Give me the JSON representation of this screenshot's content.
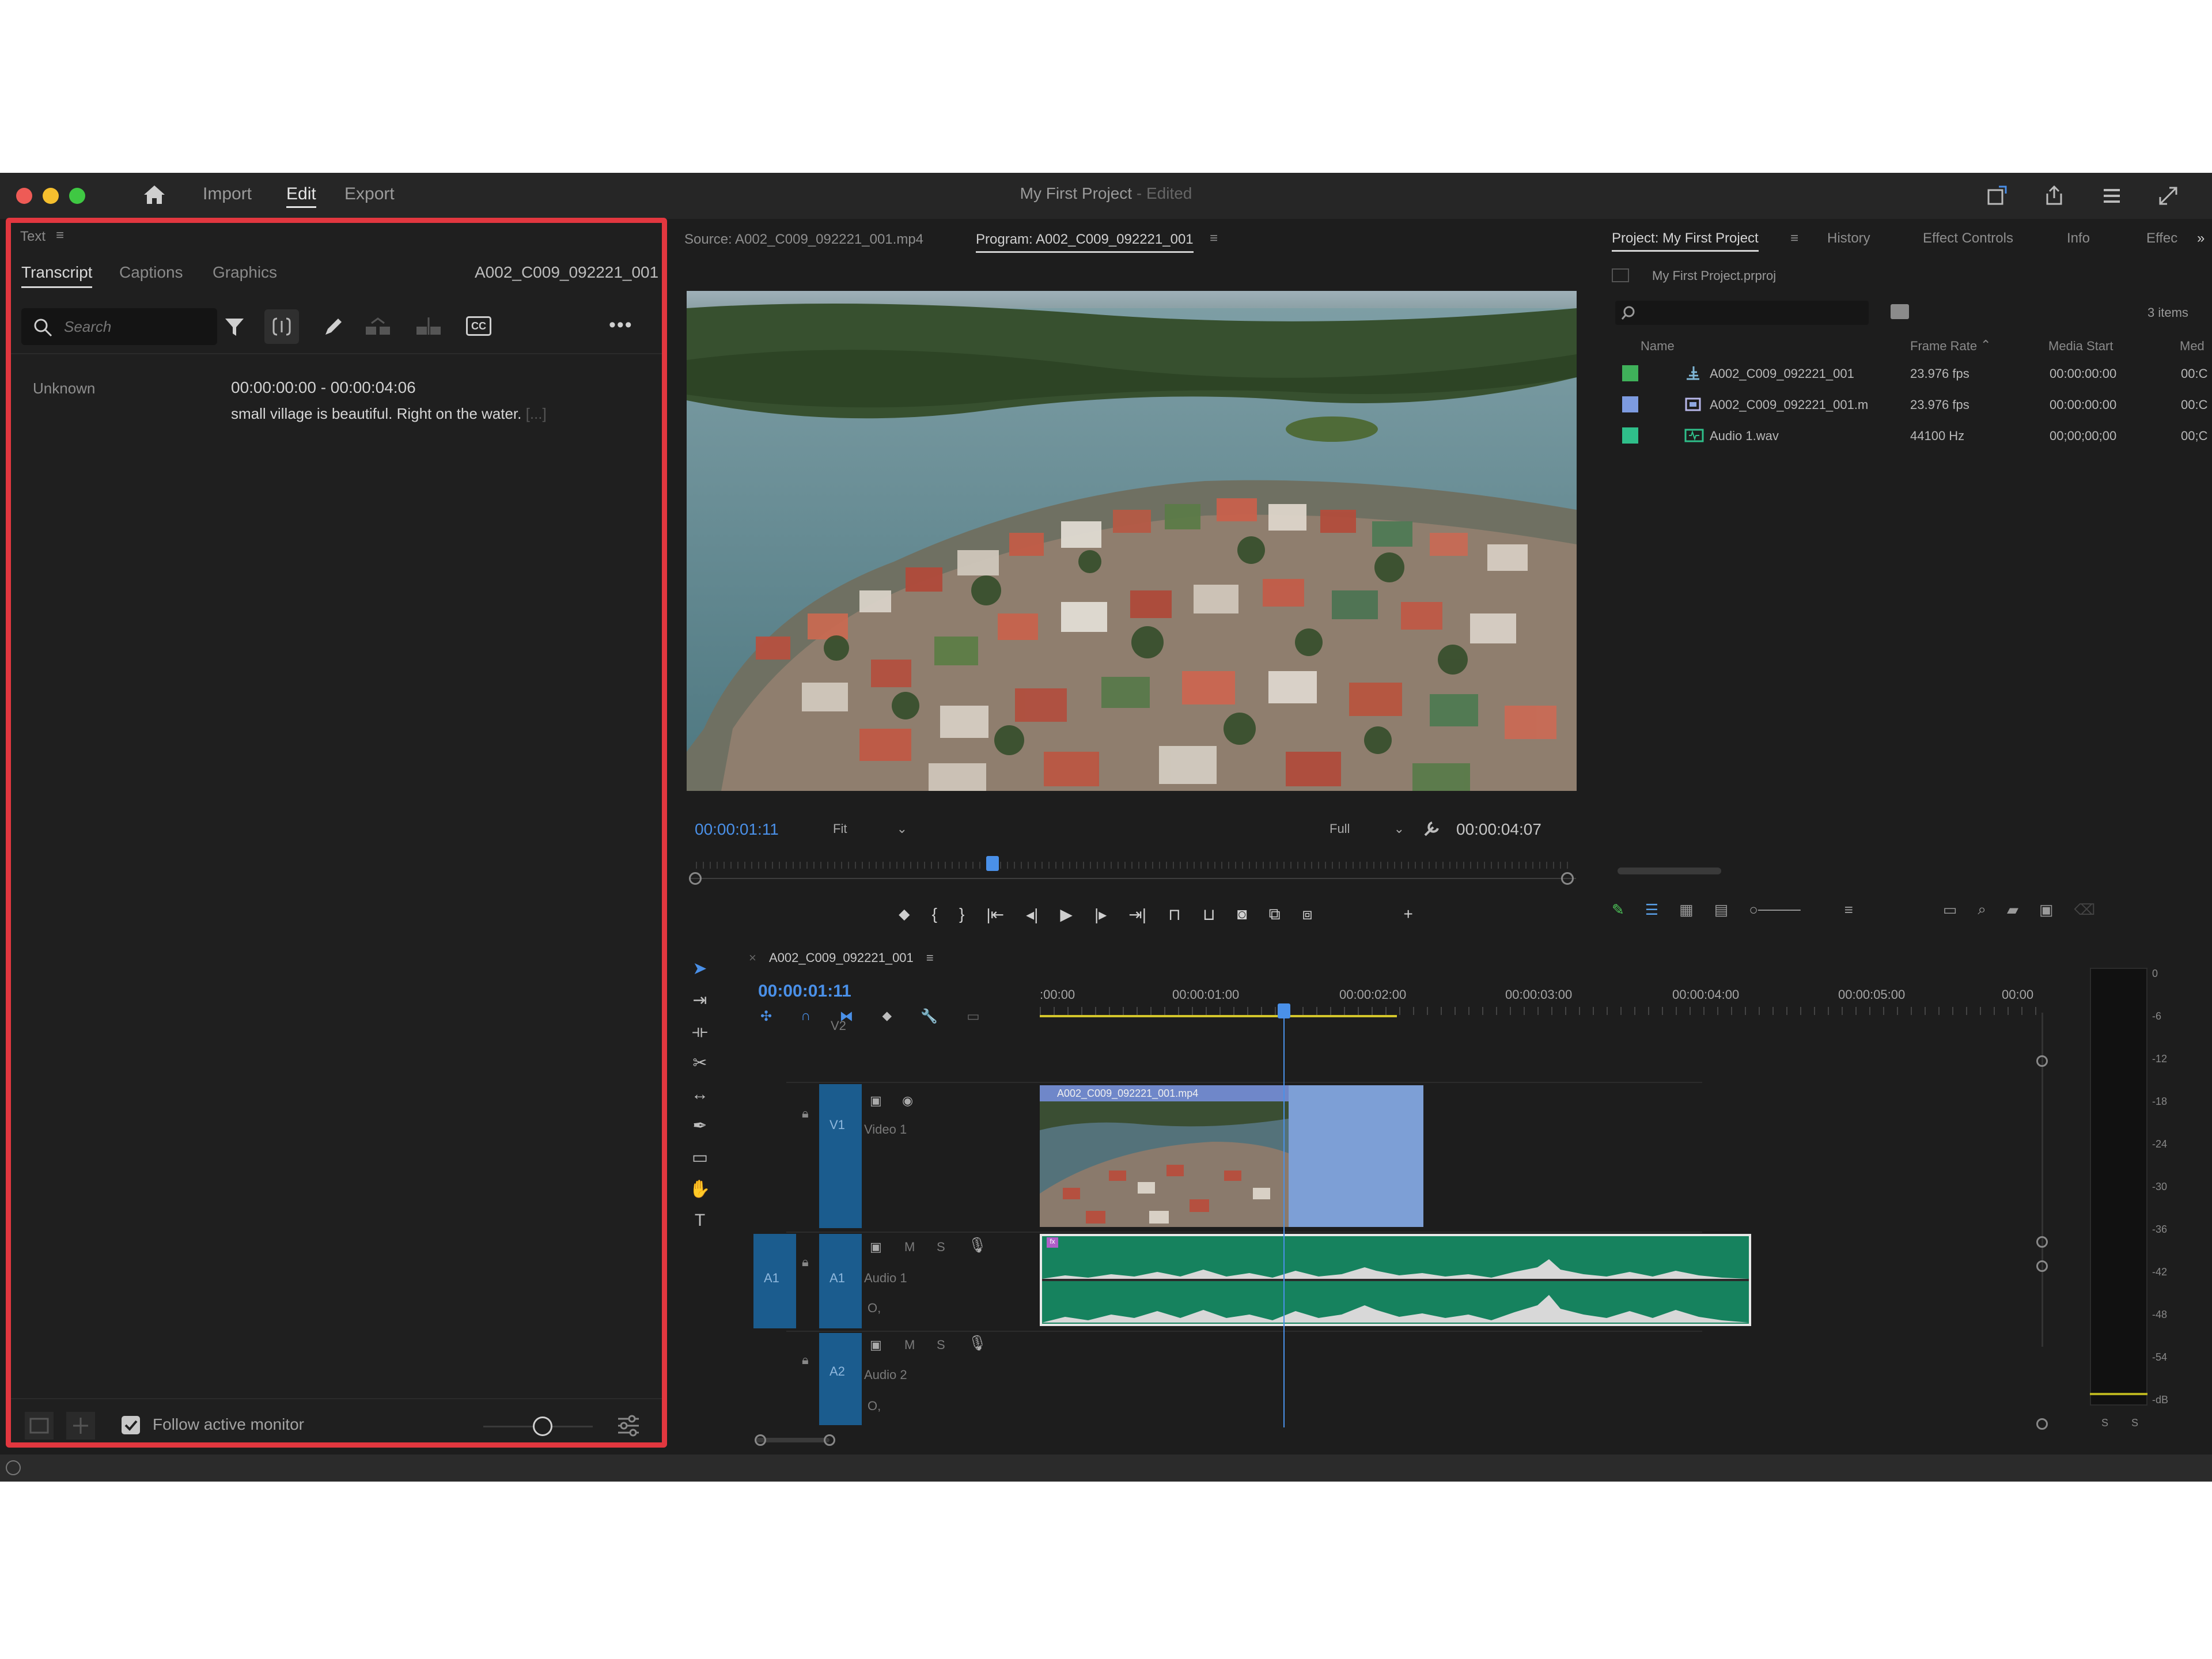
{
  "titlebar": {
    "menus": [
      "Import",
      "Edit",
      "Export"
    ],
    "project_title": "My First Project",
    "edited_suffix": " - Edited"
  },
  "text_panel": {
    "title": "Text",
    "tabs": [
      "Transcript",
      "Captions",
      "Graphics"
    ],
    "clip_name": "A002_C009_092221_001",
    "search_placeholder": "Search",
    "entry": {
      "speaker": "Unknown",
      "timecode": "00:00:00:00 - 00:00:04:06",
      "text": "small village is beautiful. Right on the water.",
      "ellipsis": "[...]"
    },
    "follow_label": "Follow active monitor",
    "follow_checked": true
  },
  "source_tab": "Source: A002_C009_092221_001.mp4",
  "program_tab": "Program: A002_C009_092221_001",
  "program_monitor": {
    "current_time": "00:00:01:11",
    "fit": "Fit",
    "quality": "Full",
    "duration": "00:00:04:07",
    "playhead_fraction": 0.34
  },
  "project_panel": {
    "tabs": [
      "Project: My First Project",
      "History",
      "Effect Controls",
      "Info",
      "Effec"
    ],
    "file": "My First Project.prproj",
    "items_count": "3 items",
    "columns": [
      "Name",
      "Frame Rate",
      "Media Start",
      "Med"
    ],
    "rows": [
      {
        "color": "#3fb15a",
        "name": "A002_C009_092221_001",
        "rate": "23.976 fps",
        "start": "00:00:00:00",
        "med": "00:C"
      },
      {
        "color": "#7d9be0",
        "name": "A002_C009_092221_001.m",
        "rate": "23.976 fps",
        "start": "00:00:00:00",
        "med": "00:C"
      },
      {
        "color": "#2fbf8a",
        "name": "Audio 1.wav",
        "rate": "44100 Hz",
        "start": "00;00;00;00",
        "med": "00;C"
      }
    ]
  },
  "timeline": {
    "sequence": "A002_C009_092221_001",
    "current_time": "00:00:01:11",
    "ruler": [
      ":00:00",
      "00:00:01:00",
      "00:00:02:00",
      "00:00:03:00",
      "00:00:04:00",
      "00:00:05:00",
      "00:00"
    ],
    "tracks": {
      "v2": "V2",
      "v1": "V1",
      "video1": "Video 1",
      "a1": "A1",
      "audio1": "Audio 1",
      "a2": "A2",
      "audio2": "Audio 2",
      "src_a1": "A1",
      "m": "M",
      "s": "S",
      "o": "O,"
    },
    "video_clip": "A002_C009_092221_001.mp4",
    "audio_clip_marker": "fx"
  },
  "meter": {
    "scale": [
      "0",
      "-6",
      "-12",
      "-18",
      "-24",
      "-30",
      "-36",
      "-42",
      "-48",
      "-54",
      "-dB"
    ],
    "solo": [
      "S",
      "S"
    ]
  }
}
